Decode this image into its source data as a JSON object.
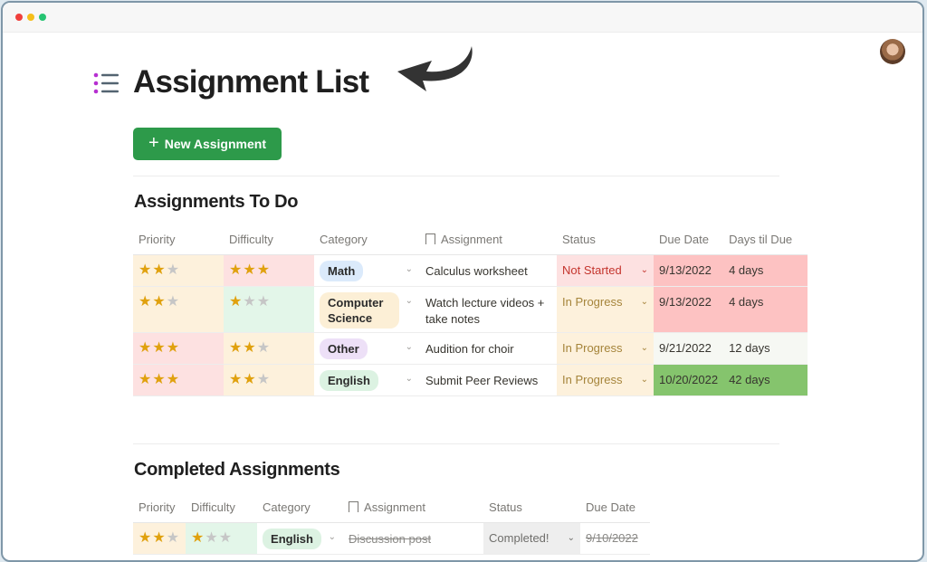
{
  "window": {
    "traffic_lights": [
      "close",
      "minimize",
      "maximize"
    ]
  },
  "header": {
    "page_icon": "bulleted-list-icon",
    "title": "Assignment List",
    "annotation": "curved-arrow-icon",
    "avatar": "user-avatar"
  },
  "toolbar": {
    "new_button_icon": "+",
    "new_button_label": "New Assignment"
  },
  "todo": {
    "title": "Assignments To Do",
    "columns": [
      "Priority",
      "Difficulty",
      "Category",
      "Assignment",
      "Status",
      "Due Date",
      "Days til Due"
    ],
    "rows": [
      {
        "priority": 2,
        "difficulty": 3,
        "category": "Math",
        "assignment": "Calculus worksheet",
        "status": "Not Started",
        "due_date": "9/13/2022",
        "days": "4 days"
      },
      {
        "priority": 2,
        "difficulty": 1,
        "category": "Computer Science",
        "assignment": "Watch lecture videos + take notes",
        "status": "In Progress",
        "due_date": "9/13/2022",
        "days": "4 days"
      },
      {
        "priority": 3,
        "difficulty": 2,
        "category": "Other",
        "assignment": "Audition for choir",
        "status": "In Progress",
        "due_date": "9/21/2022",
        "days": "12 days"
      },
      {
        "priority": 3,
        "difficulty": 2,
        "category": "English",
        "assignment": "Submit Peer Reviews",
        "status": "In Progress",
        "due_date": "10/20/2022",
        "days": "42 days"
      }
    ]
  },
  "completed": {
    "title": "Completed Assignments",
    "columns": [
      "Priority",
      "Difficulty",
      "Category",
      "Assignment",
      "Status",
      "Due Date"
    ],
    "rows": [
      {
        "priority": 2,
        "difficulty": 1,
        "category": "English",
        "assignment": "Discussion post",
        "status": "Completed!",
        "due_date": "9/10/2022"
      }
    ]
  },
  "colors": {
    "accent_green": "#2d9a4a",
    "star_on": "#e0a10e",
    "star_off": "#c6c6c6",
    "bg_priority_2": "#fdf1dc",
    "bg_priority_3": "#fde1e1",
    "bg_difficulty_3": "#fde1e1",
    "bg_difficulty_2": "#fdf1dc",
    "bg_difficulty_1": "#e3f6e9",
    "tag_math": "#dbeafb",
    "tag_cs": "#fcefd6",
    "tag_other": "#ede0f7",
    "tag_english": "#dcf2e2",
    "status_not_started_bg": "#fde1e1",
    "status_not_started_fg": "#c4342d",
    "status_in_progress_bg": "#fdf1dc",
    "status_in_progress_fg": "#a5843a",
    "status_completed_bg": "#eeeeee",
    "status_completed_fg": "#6f6e6b",
    "due_urgent": "#fdc2c2",
    "due_normal": "#f6f8f3",
    "due_far": "#85c46d"
  }
}
